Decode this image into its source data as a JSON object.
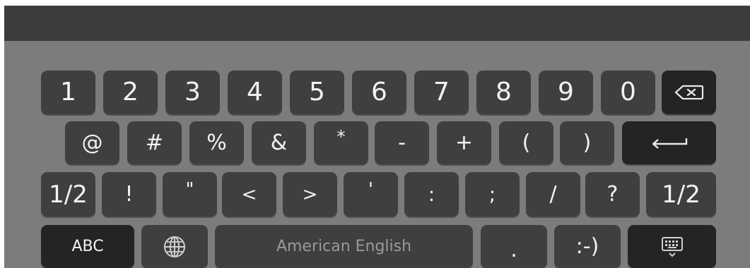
{
  "keyboard": {
    "row1": [
      "1",
      "2",
      "3",
      "4",
      "5",
      "6",
      "7",
      "8",
      "9",
      "0"
    ],
    "row2": [
      "@",
      "#",
      "%",
      "&",
      "*",
      "-",
      "+",
      "(",
      ")"
    ],
    "row3": [
      "1/2",
      "!",
      "\"",
      "<",
      ">",
      "'",
      ":",
      ";",
      "/",
      "?",
      "1/2"
    ],
    "row4": {
      "abc_label": "ABC",
      "space_label": "American English",
      "period_label": ".",
      "smiley_label": ":-)"
    },
    "icons": {
      "backspace": "backspace-icon",
      "enter": "enter-icon",
      "globe": "globe-icon",
      "hide_keyboard": "keyboard-hide-icon"
    }
  }
}
